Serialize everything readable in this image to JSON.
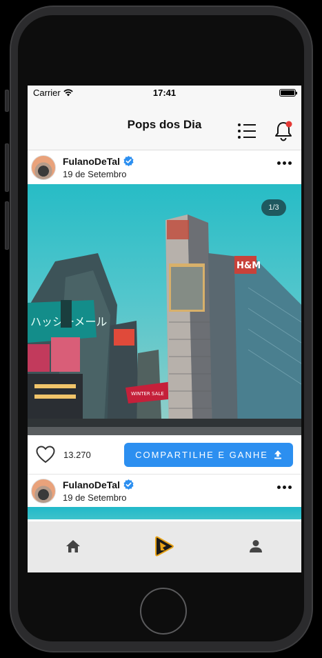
{
  "status_bar": {
    "carrier": "Carrier",
    "time": "17:41"
  },
  "header": {
    "title": "Pops dos Dia",
    "notification_dot_color": "#e53935"
  },
  "posts": [
    {
      "user": "FulanoDeTal",
      "date": "19 de Setembro",
      "verified": true,
      "image_counter": "1/3",
      "likes": "13.270",
      "share_label": "COMPARTILHE E GANHE"
    },
    {
      "user": "FulanoDeTal",
      "date": "19 de Setembro",
      "verified": true
    }
  ],
  "bottom_nav": {
    "items": [
      {
        "name": "home",
        "icon": "home-icon"
      },
      {
        "name": "play",
        "icon": "play-logo-icon"
      },
      {
        "name": "profile",
        "icon": "person-icon"
      }
    ]
  },
  "colors": {
    "accent": "#2c8ff0",
    "verified": "#2c8ff0",
    "nav_bg": "#e9e9e9"
  }
}
